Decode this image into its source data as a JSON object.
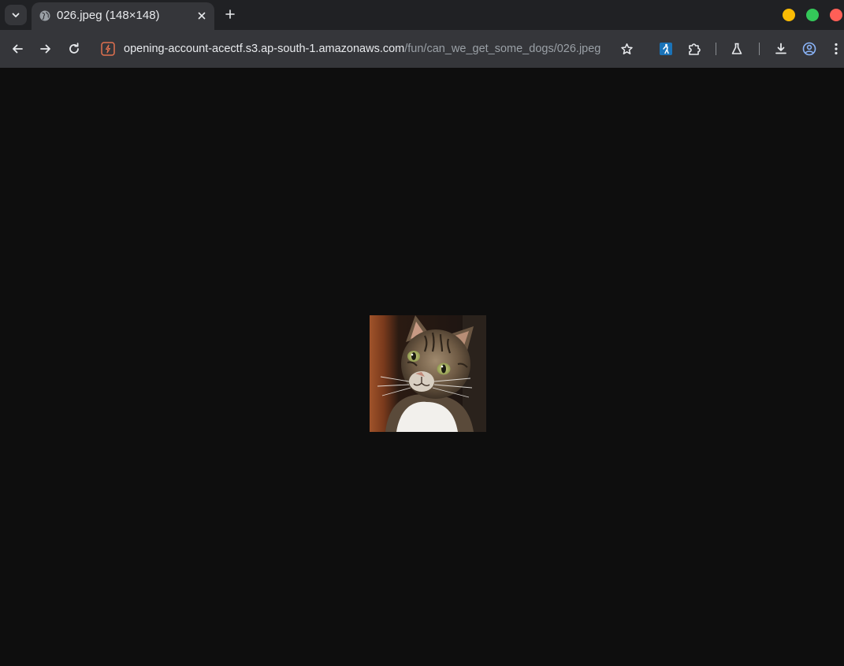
{
  "tab": {
    "title": "026.jpeg (148×148)"
  },
  "address_bar": {
    "host": "opening-account-acectf.s3.ap-south-1.amazonaws.com",
    "path": "/fun/can_we_get_some_dogs/026.jpeg"
  },
  "icons": {
    "tab_search": "chevron-down-icon",
    "favicon": "globe-icon",
    "tab_close": "close-icon",
    "new_tab": "plus-icon",
    "back": "arrow-left-icon",
    "forward": "arrow-right-icon",
    "reload": "reload-icon",
    "site_info": "site-info-icon",
    "bookmark": "star-icon",
    "extension_1": "accessibility-extension-icon",
    "extensions": "puzzle-icon",
    "labs": "flask-icon",
    "downloads": "download-icon",
    "profile": "profile-icon",
    "menu": "kebab-menu-icon"
  },
  "colors": {
    "window_minimize": "#fbbc04",
    "window_maximize": "#34c759",
    "window_close": "#ff5f57",
    "page_background": "#0e0e0e"
  },
  "image": {
    "subject": "tabby cat portrait"
  }
}
